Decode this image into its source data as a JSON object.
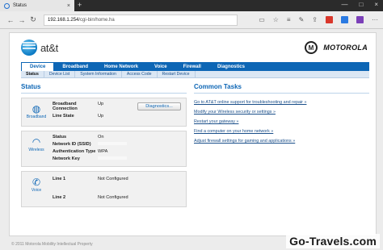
{
  "browser": {
    "tab_title": "Status",
    "tab_close": "×",
    "new_tab": "+",
    "win_controls": [
      "—",
      "□",
      "×"
    ],
    "nav": {
      "back": "←",
      "forward": "→",
      "refresh": "↻"
    },
    "url_host": "192.168.1.254",
    "url_path": "/cgi-bin/home.ha",
    "toolbar_icons": [
      "reading-view",
      "favorites-star",
      "favorites-hub",
      "pen",
      "share"
    ],
    "toolbar_colors": [
      "#d9372b",
      "#2a7ae2",
      "#7b3fb8"
    ]
  },
  "brand": {
    "att": "at&t",
    "motorola_mark": "M",
    "motorola": "MOTOROLA"
  },
  "nav": {
    "tabs": [
      "Device",
      "Broadband",
      "Home Network",
      "Voice",
      "Firewall",
      "Diagnostics"
    ],
    "active": "Device",
    "subtabs": [
      "Status",
      "Device List",
      "System Information",
      "Access Code",
      "Restart Device"
    ],
    "active_sub": "Status"
  },
  "status": {
    "title": "Status",
    "broadband": {
      "label": "Broadband",
      "rows": [
        {
          "k": "Broadband Connection",
          "v": "Up"
        },
        {
          "k": "Line State",
          "v": "Up"
        }
      ],
      "button": "Diagnostics..."
    },
    "wireless": {
      "label": "Wireless",
      "rows": [
        {
          "k": "Status",
          "v": "On"
        },
        {
          "k": "Network ID (SSID)",
          "v": ""
        },
        {
          "k": "Authentication Type",
          "v": "WPA"
        },
        {
          "k": "Network Key",
          "v": ""
        }
      ]
    },
    "voice": {
      "label": "Voice",
      "rows": [
        {
          "k": "Line 1",
          "v": "Not Configured"
        },
        {
          "k": "Line 2",
          "v": "Not Configured"
        }
      ]
    }
  },
  "tasks": {
    "title": "Common Tasks",
    "items": [
      "Go to AT&T online support for troubleshooting and repair »",
      "Modify your Wireless security or settings »",
      "Restart your gateway »",
      "Find a computer on your home network »",
      "Adjust firewall settings for gaming and applications »"
    ]
  },
  "footer": "© 2011 Motorola Mobility Intellectual Property",
  "watermark": "Go-Travels.com"
}
